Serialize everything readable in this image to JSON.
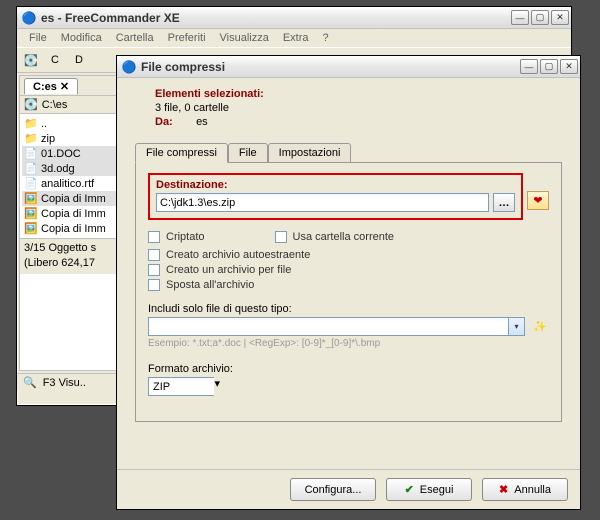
{
  "main": {
    "title": "es - FreeCommander XE",
    "menu": [
      "File",
      "Modifica",
      "Cartella",
      "Preferiti",
      "Visualizza",
      "Extra",
      "?"
    ],
    "drive_letter": "D",
    "panel_tab": "C:es",
    "address": "C:\\es",
    "files": [
      {
        "icon": "📁",
        "name": ".."
      },
      {
        "icon": "📁",
        "name": "zip"
      },
      {
        "icon": "📄",
        "name": "01.DOC"
      },
      {
        "icon": "📄",
        "name": "3d.odg"
      },
      {
        "icon": "📄",
        "name": "analitico.rtf"
      },
      {
        "icon": "🖼️",
        "name": "Copia di Imm"
      },
      {
        "icon": "🖼️",
        "name": "Copia di Imm"
      },
      {
        "icon": "🖼️",
        "name": "Copia di Imm"
      }
    ],
    "footer1": "3/15 Oggetto s",
    "footer2": "(Libero 624,17",
    "status_key": "F3 Visu.."
  },
  "dialog": {
    "title": "File compressi",
    "sel_head": "Elementi selezionati:",
    "sel_sub": "3 file, 0 cartelle",
    "da_label": "Da:",
    "da_value": "es",
    "tabs": [
      "File compressi",
      "File",
      "Impostazioni"
    ],
    "dest_label": "Destinazione:",
    "dest_value": "C:\\jdk1.3\\es.zip",
    "chk_encrypted": "Criptato",
    "chk_usecur": "Usa cartella corrente",
    "chk_sfx": "Creato archivio autoestraente",
    "chk_perfile": "Creato un archivio per file",
    "chk_move": "Sposta all'archivio",
    "include_label": "Includi solo file di questo tipo:",
    "include_hint": "Esempio: *.txt;a*.doc | <RegExp>: [0-9]*_[0-9]*\\.bmp",
    "format_label": "Formato archivio:",
    "format_value": "ZIP",
    "btn_config": "Configura...",
    "btn_ok": "Esegui",
    "btn_cancel": "Annulla"
  }
}
